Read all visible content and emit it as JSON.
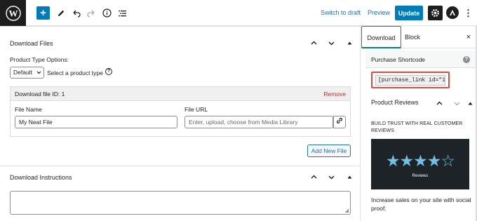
{
  "toolbar": {
    "plus": "+",
    "switch_to_draft": "Switch to draft",
    "preview": "Preview",
    "update": "Update",
    "more": "⋮",
    "icons": [
      "wordpress-logo",
      "add-block",
      "edit-pencil",
      "undo",
      "redo",
      "info",
      "list-view",
      "settings-gear",
      "astra-logo",
      "more-options"
    ]
  },
  "download_files": {
    "title": "Download Files",
    "product_type_label": "Product Type Options:",
    "product_type_selected": "Default",
    "product_type_hint": "Select a product type",
    "help": "?",
    "file_box": {
      "heading": "Download file ID: 1",
      "remove": "Remove",
      "file_name_label": "File Name",
      "file_name_value": "My Neat File",
      "file_url_label": "File URL",
      "file_url_placeholder": "Enter, upload, choose from Media Library"
    },
    "add_new_file": "Add New File"
  },
  "download_instructions": {
    "title": "Download Instructions"
  },
  "sidebar": {
    "tabs": [
      "Download",
      "Block"
    ],
    "close": "×",
    "purchase_shortcode": {
      "title": "Purchase Shortcode",
      "help": "?",
      "value": "[purchase_link id=\"1387"
    },
    "product_reviews": {
      "title": "Product Reviews",
      "subtitle": "BUILD TRUST WITH REAL CUSTOMER REVIEWS",
      "stars": "★★★★☆",
      "rating": 4.5,
      "banner_label": "Reviews",
      "text": "Increase sales on your site with social proof."
    }
  },
  "colors": {
    "accent": "#007cba",
    "highlight": "#e14b3b",
    "star": "#6ec1e4",
    "banner_bg": "#1d2327",
    "remove": "#b32d2e"
  }
}
